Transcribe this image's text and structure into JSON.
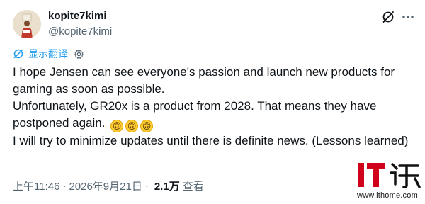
{
  "user": {
    "display_name": "kopite7kimi",
    "handle": "@kopite7kimi"
  },
  "actions": {
    "grok_icon": "grok-slash-icon",
    "more_icon": "more-horizontal-icon"
  },
  "translate": {
    "label": "显示翻译"
  },
  "tweet": {
    "line1": "I hope Jensen can see everyone's passion and launch new products for gaming as soon as possible.",
    "line2": "Unfortunately, GR20x is a product from 2028. That means they have postponed again.",
    "emoji": [
      "🙃",
      "🙃",
      "🙃"
    ],
    "line3": "I will try to minimize updates until there is definite news. (Lessons learned)"
  },
  "meta": {
    "time": "上午11:46",
    "date": "2026年9月21日",
    "views_count": "2.1万",
    "views_label": "查看"
  },
  "watermark": {
    "logo_text": "IT之家",
    "url": "www.ithome.com"
  },
  "colors": {
    "text": "#0f1419",
    "secondary": "#536471",
    "link": "#1d9bf0",
    "watermark_red": "#d0021b"
  }
}
